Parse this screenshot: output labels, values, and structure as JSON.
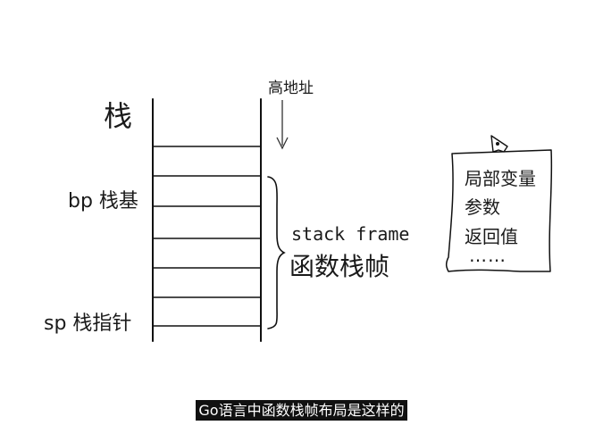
{
  "diagram": {
    "stack_title": "栈",
    "high_address": "高地址",
    "bp_label": "bp 栈基",
    "sp_label": "sp 栈指针",
    "frame_label_en": "stack frame",
    "frame_label_cn": "函数栈帧",
    "rows": 8
  },
  "note": {
    "lines": [
      "局部变量",
      "参数",
      "返回值"
    ],
    "more": "……"
  },
  "subtitle": "Go语言中函数栈帧布局是这样的"
}
